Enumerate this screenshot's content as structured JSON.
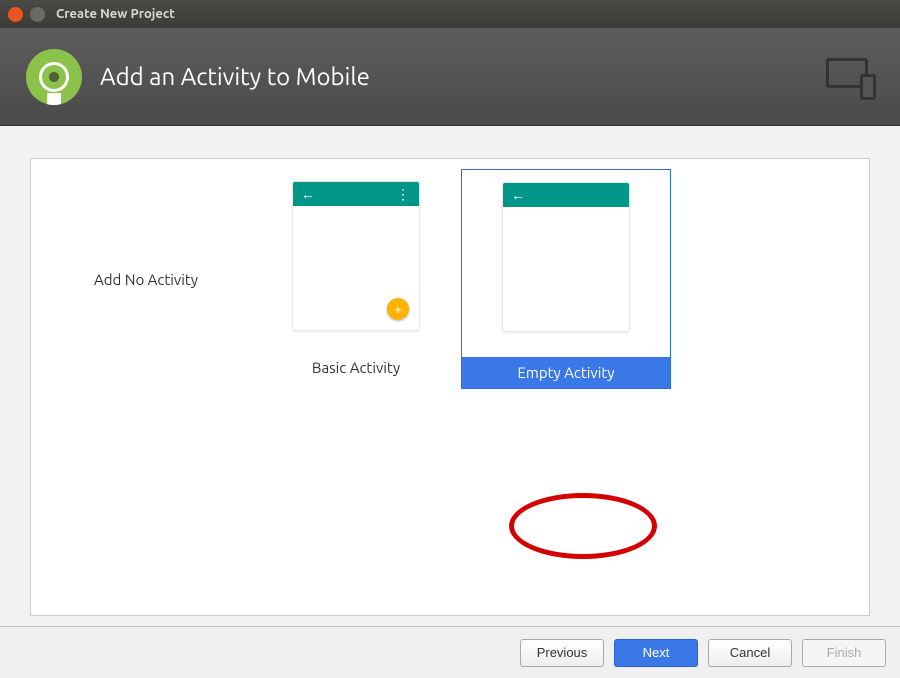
{
  "window": {
    "title": "Create New Project"
  },
  "header": {
    "title": "Add an Activity to Mobile"
  },
  "tiles": {
    "none": {
      "label": "Add No Activity"
    },
    "basic": {
      "label": "Basic Activity"
    },
    "empty": {
      "label": "Empty Activity",
      "selected": true
    }
  },
  "footer": {
    "previous": "Previous",
    "next": "Next",
    "cancel": "Cancel",
    "finish": "Finish"
  },
  "colors": {
    "accent": "#3b78e7",
    "teal": "#009688",
    "fab": "#ffb300",
    "logo": "#8bc34a",
    "annotation": "#d40000"
  }
}
